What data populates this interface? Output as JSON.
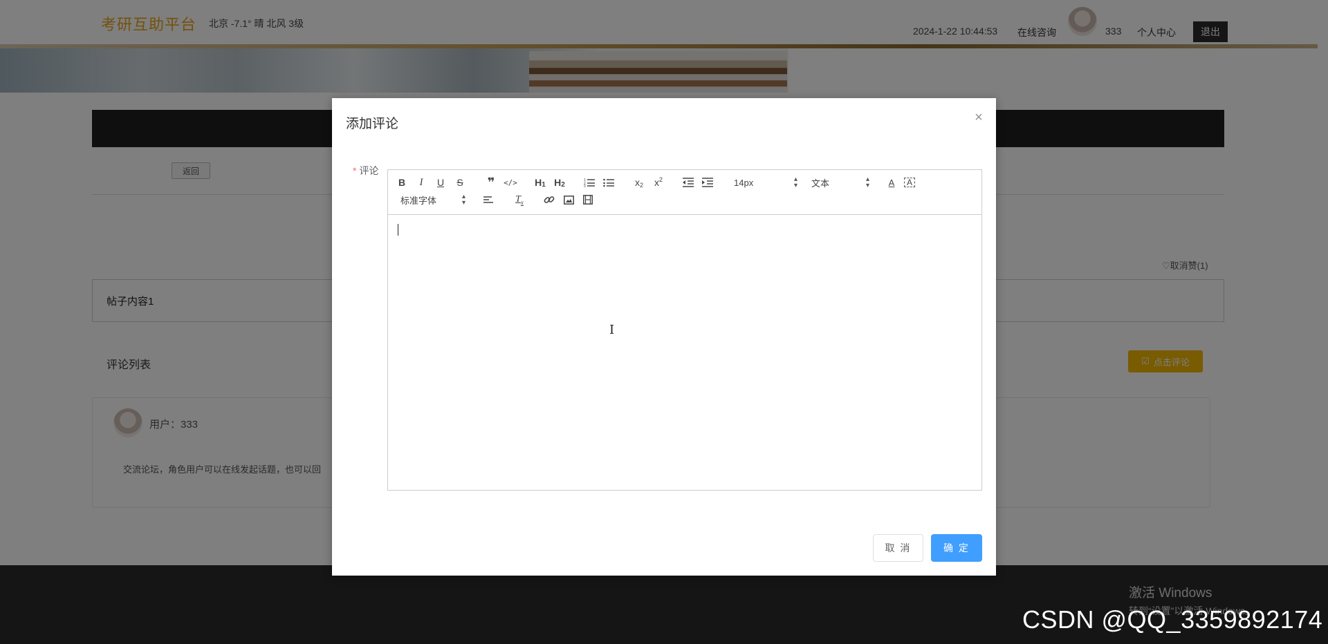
{
  "header": {
    "brand": "考研互助平台",
    "weather": "北京  -7.1°  晴  北风  3级",
    "datetime": "2024-1-22 10:44:53",
    "consult_label": "在线咨询",
    "username": "333",
    "center_label": "个人中心",
    "logout_label": "退出"
  },
  "page": {
    "back_label": "返回",
    "unlike_label": "取消赞(1)",
    "post_content": "帖子内容1",
    "comments_title": "评论列表",
    "comment_button_label": "点击评论",
    "comment": {
      "user": "用户：333",
      "text": "交流论坛，角色用户可以在线发起话题，也可以回"
    }
  },
  "dialog": {
    "title": "添加评论",
    "field_label": "评论",
    "required_mark": "*",
    "font_size_value": "14px",
    "heading_value": "文本",
    "font_family_value": "标准字体",
    "cancel_label": "取 消",
    "confirm_label": "确 定",
    "colors": {
      "primary": "#409eff",
      "accent": "#f2b705",
      "brand": "#e8a317"
    }
  },
  "icons": [
    "close-icon",
    "bold-icon",
    "italic-icon",
    "underline-icon",
    "strike-icon",
    "blockquote-icon",
    "code-icon",
    "h1-icon",
    "h2-icon",
    "ordered-list-icon",
    "bullet-list-icon",
    "subscript-icon",
    "superscript-icon",
    "outdent-icon",
    "indent-icon",
    "font-color-icon",
    "background-color-icon",
    "align-icon",
    "clear-format-icon",
    "link-icon",
    "image-icon",
    "video-icon",
    "heart-icon",
    "edit-icon"
  ],
  "system": {
    "activate_title": "激活 Windows",
    "activate_sub": "转到“设置”以激活 Windows。",
    "watermark": "CSDN @QQ_3359892174"
  }
}
